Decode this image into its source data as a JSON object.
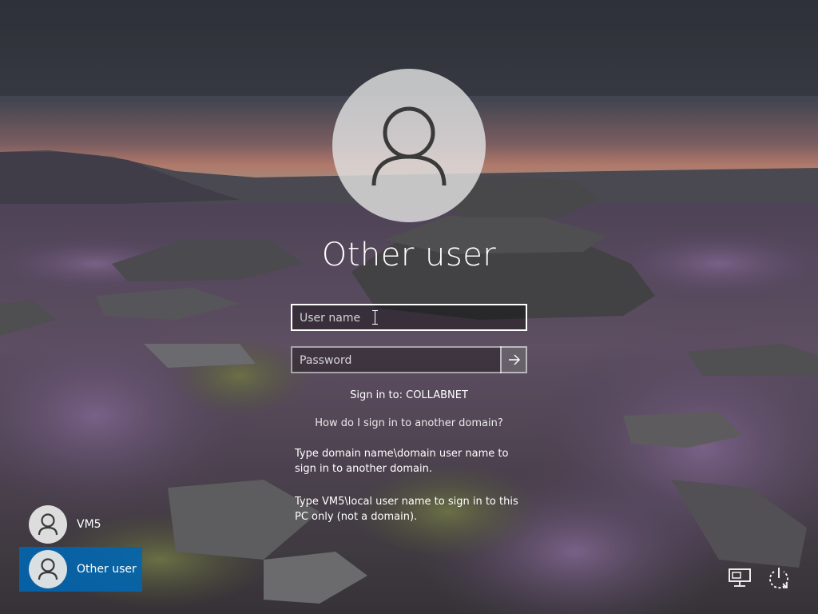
{
  "login": {
    "title": "Other user",
    "username_placeholder": "User name",
    "password_placeholder": "Password",
    "sign_in_to": "Sign in to: COLLABNET",
    "help_link": "How do I sign in to another domain?",
    "help_line1": "Type domain name\\domain user name to sign in to another domain.",
    "help_line2": "Type VM5\\local user name to sign in to this PC only (not a domain)."
  },
  "users": [
    {
      "name": "VM5",
      "selected": false,
      "icon": "user-icon"
    },
    {
      "name": "Other user",
      "selected": true,
      "icon": "user-icon"
    }
  ],
  "system_icons": {
    "network": "network-icon",
    "power": "power-icon"
  },
  "colors": {
    "selected_tile": "#0067B2",
    "text": "#FFFFFF"
  }
}
